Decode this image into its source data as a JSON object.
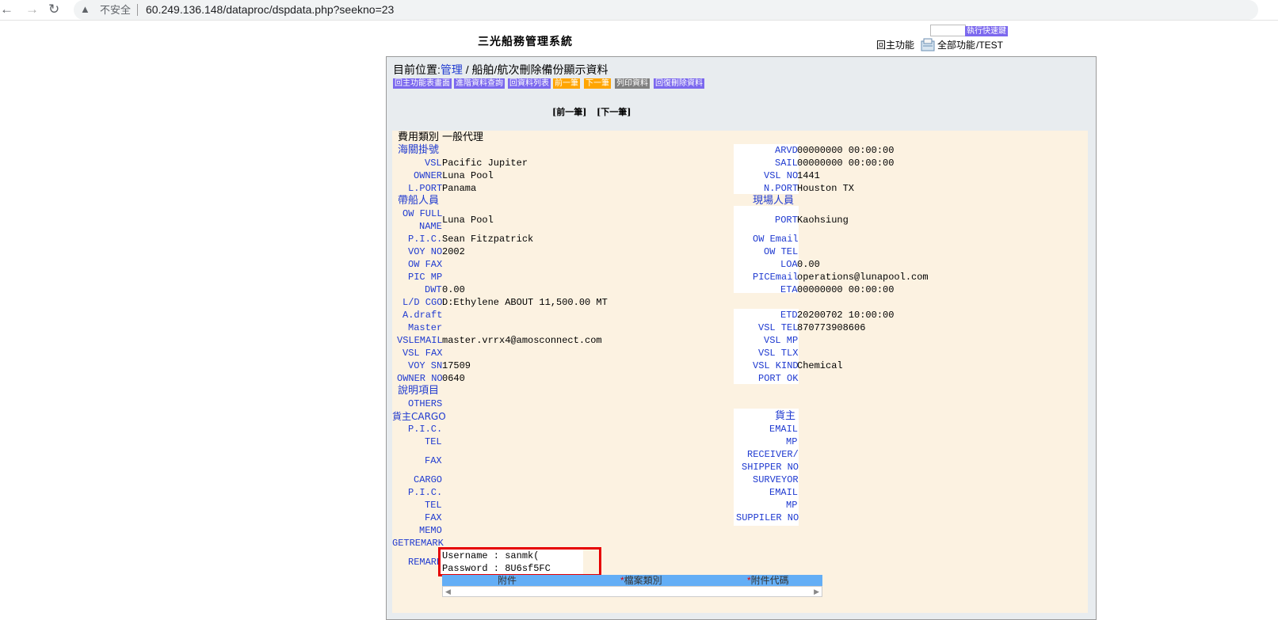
{
  "browser": {
    "insecure_label": "不安全",
    "url": "60.249.136.148/dataproc/dspdata.php?seekno=23"
  },
  "header": {
    "system_title": "三光船務管理系統",
    "quick_link_button": "執行快速鍵",
    "home_link": "回主功能",
    "all_functions_link": "全部功能",
    "user": "/TEST"
  },
  "breadcrumb": {
    "prefix": "目前位置:",
    "link": "管理",
    "rest": " / 船舶/航次刪除備份顯示資料"
  },
  "toolbar": {
    "buttons": [
      "回主功能表畫面",
      "進階資料查詢",
      "回資料列表",
      "前一筆",
      "下一筆",
      "列印資料",
      "回復刪除資料"
    ],
    "colors": [
      "#7b68ee",
      "#7b68ee",
      "#7b68ee",
      "#ffa500",
      "#ffa500",
      "#808080",
      "#7b68ee"
    ]
  },
  "pager": {
    "prev": "[前一筆]",
    "next": "[下一筆]"
  },
  "left": {
    "expense_type_label": "費用類別",
    "expense_type_value": "一般代理",
    "customs_label": "海關掛號",
    "vsl_label": "VSL",
    "vsl_value": "Pacific Jupiter",
    "owner_label": "OWNER",
    "owner_value": "Luna Pool",
    "lport_label": "L.PORT",
    "lport_value": "Panama",
    "escort_label": "帶船人員",
    "ow_full_label_1": "OW FULL",
    "ow_full_label_2": "NAME",
    "ow_full_value": "Luna Pool",
    "pic_label": "P.I.C.",
    "pic_value": "Sean Fitzpatrick",
    "voy_no_label": "VOY NO",
    "voy_no_value": "2002",
    "ow_fax_label": "OW FAX",
    "pic_mp_label": "PIC MP",
    "dwt_label": "DWT",
    "dwt_value": "0.00",
    "ld_cgo_label": "L/D CGO",
    "ld_cgo_value": "D:Ethylene ABOUT 11,500.00 MT",
    "adraft_label": "A.draft",
    "master_label": "Master",
    "vslemail_label": "VSLEMAIL",
    "vslemail_value": "master.vrrx4@amosconnect.com",
    "vsl_fax_label": "VSL FAX",
    "voy_sn_label": "VOY SN",
    "voy_sn_value": "17509",
    "owner_no_label": "OWNER NO",
    "owner_no_value": "0640",
    "desc_label": "說明項目",
    "others_label": "OTHERS",
    "cargo_owner_label": "貨主CARGO",
    "pic2_label": "P.I.C.",
    "tel_label": "TEL",
    "fax_label": "FAX",
    "cargo_label": "CARGO",
    "pic3_label": "P.I.C.",
    "tel2_label": "TEL",
    "fax2_label": "FAX",
    "memo_label": "MEMO",
    "getremark_label": "GETREMARK",
    "remark_label": "REMARK",
    "remark_line1": "Username : sanmk(",
    "remark_line2": "Password : 8U6sf5FC"
  },
  "right": {
    "arvd_label": "ARVD",
    "arvd_value": "00000000 00:00:00",
    "sail_label": "SAIL",
    "sail_value": "00000000 00:00:00",
    "vsl_no_label": "VSL NO",
    "vsl_no_value": "1441",
    "nport_label": "N.PORT",
    "nport_value": "Houston TX",
    "onsite_label": "現場人員",
    "port_label": "PORT",
    "port_value": "Kaohsiung",
    "ow_email_label": "OW Email",
    "ow_tel_label": "OW TEL",
    "loa_label": "LOA",
    "loa_value": "0.00",
    "picemail_label": "PICEmail",
    "picemail_value": "operations@lunapool.com",
    "eta_label": "ETA",
    "eta_value": "00000000 00:00:00",
    "etd_label": "ETD",
    "etd_value": "20200702 10:00:00",
    "vsl_tel_label": "VSL TEL",
    "vsl_tel_value": "870773908606",
    "vsl_mp_label": "VSL MP",
    "vsl_tlx_label": "VSL TLX",
    "vsl_kind_label": "VSL KIND",
    "vsl_kind_value": "Chemical",
    "port_ok_label": "PORT OK",
    "cargo_owner_label": "貨主",
    "email_label": "EMAIL",
    "mp_label": "MP",
    "receiver_label_1": "RECEIVER/",
    "receiver_label_2": "SHIPPER NO",
    "surveyor_label": "SURVEYOR",
    "email2_label": "EMAIL",
    "mp2_label": "MP",
    "suppiler_label": "SUPPILER NO"
  },
  "attachments": {
    "columns": [
      "附件",
      "*檔案類別",
      "*附件代碼"
    ]
  },
  "colors": {
    "label_blue": "#1f3ad0",
    "highlight_red": "#e60000",
    "panel_bg": "#e8ecef",
    "content_bg": "#fcf2e1",
    "table_header_blue": "#63aef6"
  }
}
